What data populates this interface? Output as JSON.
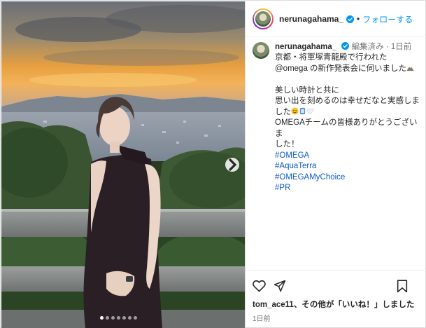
{
  "header": {
    "username": "nerunagahama_",
    "separator": "•",
    "follow_label": "フォローする"
  },
  "caption": {
    "username": "nerunagahama_",
    "meta": "編集済み · 1日前",
    "lines": [
      "京都・将軍塚青龍殿で行われた",
      "@omega の新作発表会に伺いました",
      "",
      "美しい時計と共に",
      "思い出を刻めるのは幸せだなと実感しま",
      "した",
      "OMEGAチームの皆様ありがとうございま",
      "した！"
    ],
    "hashtags": [
      "#OMEGA",
      "#AquaTerra",
      "#OMEGAMyChoice",
      "#PR"
    ]
  },
  "actions": {
    "likes_user": "tom_ace11",
    "likes_rest": "、その他が「いいね！」しました",
    "time": "1日前"
  },
  "carousel": {
    "dot_count": 7,
    "active_index": 0
  },
  "colors": {
    "link": "#0095f6",
    "hashtag": "#00376b",
    "meta": "#737373",
    "border": "#dbdbdb"
  }
}
